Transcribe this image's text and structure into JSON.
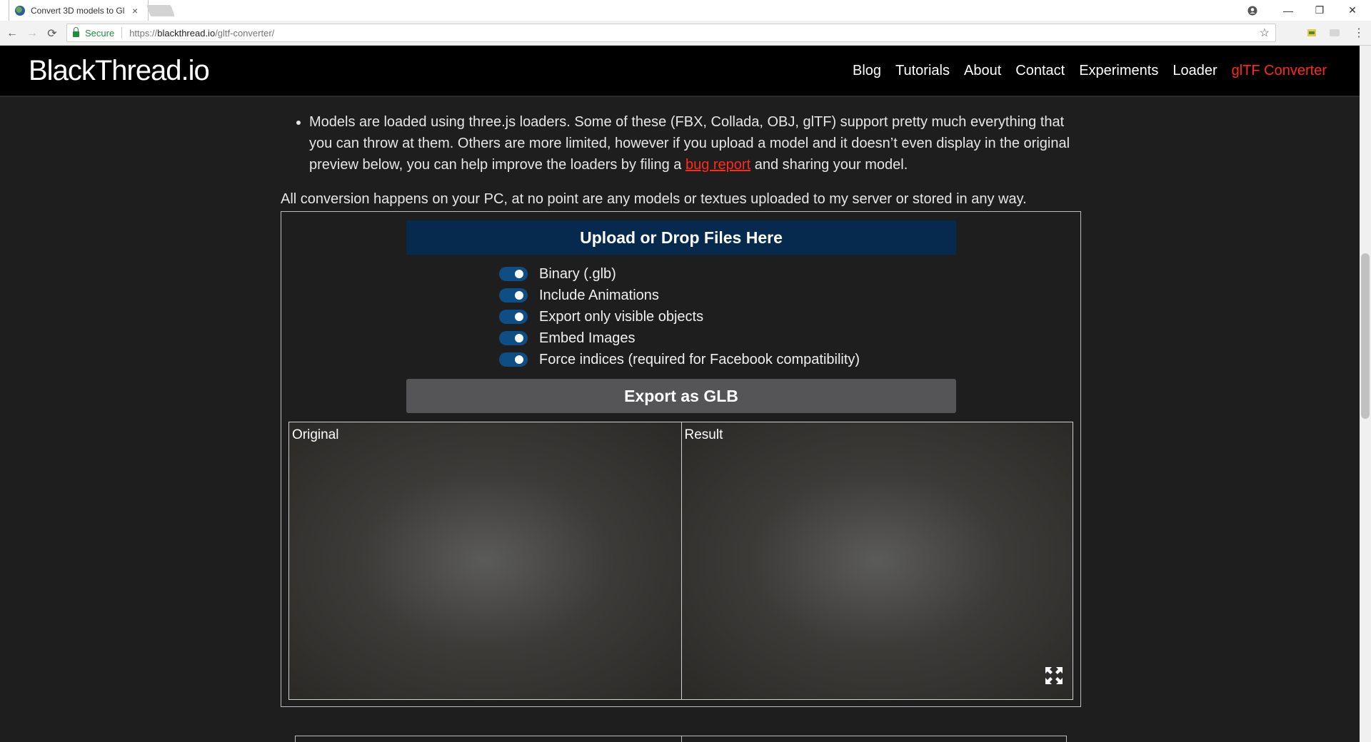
{
  "browser": {
    "tab_title": "Convert 3D models to Gl",
    "tab_close": "×",
    "secure_label": "Secure",
    "url_proto": "https://",
    "url_host": "blackthread.io",
    "url_path": "/gltf-converter/",
    "controls": {
      "back": "←",
      "forward": "→",
      "reload": "⟳",
      "star": "☆",
      "menu": "⋮",
      "minimize": "—",
      "restore": "❐",
      "close": "✕"
    }
  },
  "header": {
    "logo": "BlackThread.io",
    "nav": [
      "Blog",
      "Tutorials",
      "About",
      "Contact",
      "Experiments",
      "Loader",
      "glTF Converter"
    ],
    "active_nav": "glTF Converter",
    "accent_color": "#ff2a1a"
  },
  "content": {
    "bullet_text_1": "Models are loaded using three.js loaders. Some of these (FBX, Collada, OBJ, glTF) support pretty much everything that you can throw at them. Others are more limited, however if you upload a model and it doesn’t even display in the original preview below, you can help improve the loaders by filing a ",
    "bullet_link": "bug report",
    "bullet_text_2": " and sharing your model.",
    "note": "All conversion happens on your PC, at no point are any models or textues uploaded to my server or stored in any way."
  },
  "converter": {
    "upload_label": "Upload or Drop Files Here",
    "options": [
      {
        "label": "Binary (.glb)",
        "enabled": true
      },
      {
        "label": "Include Animations",
        "enabled": true
      },
      {
        "label": "Export only visible objects",
        "enabled": true
      },
      {
        "label": "Embed Images",
        "enabled": true
      },
      {
        "label": "Force indices (required for Facebook compatibility)",
        "enabled": true
      }
    ],
    "export_label": "Export as GLB",
    "viewer_original": "Original",
    "viewer_result": "Result",
    "toggle_color": "#0e4e84",
    "upload_color": "#062a4e"
  }
}
